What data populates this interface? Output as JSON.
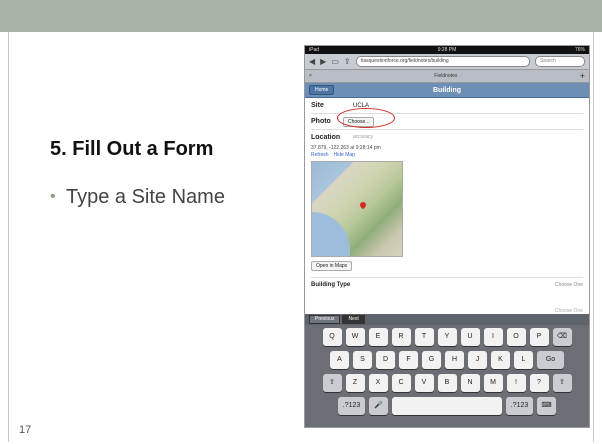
{
  "slide": {
    "title": "5. Fill Out a Form",
    "bullet": "Type a Site Name",
    "number": "17",
    "header_color": "#a9b3a4"
  },
  "ipad": {
    "status": {
      "left": "iPad",
      "center": "9:28 PM",
      "right": "76%"
    },
    "url": "hasquestionforce.org/fieldnotes/building",
    "search_placeholder": "Search",
    "tab_title": "Fieldnotes",
    "home_label": "Home",
    "nav_title": "Building",
    "site_label": "Site",
    "site_value": "UCLA",
    "photo_label": "Photo",
    "choose_label": "Choose...",
    "location_label": "Location",
    "location_hint": "accuracy",
    "coords": "37.879, -122.263 at 9:28:14 pm",
    "refresh": "Refresh",
    "hide_map": "Hide Map",
    "open_maps": "Open in Maps",
    "building_type_label": "Building Type",
    "choose_one": "Choose One",
    "previous": "Previous",
    "next": "Next",
    "keyboard": {
      "row1": [
        "Q",
        "W",
        "E",
        "R",
        "T",
        "Y",
        "U",
        "I",
        "O",
        "P",
        "⌫"
      ],
      "row2": [
        "A",
        "S",
        "D",
        "F",
        "G",
        "H",
        "J",
        "K",
        "L",
        "Go"
      ],
      "row3": [
        "⇧",
        "Z",
        "X",
        "C",
        "V",
        "B",
        "N",
        "M",
        "!",
        "?",
        "⇧"
      ],
      "row4": [
        ".?123",
        "🎤",
        "",
        ".?123",
        "⌨"
      ]
    }
  }
}
